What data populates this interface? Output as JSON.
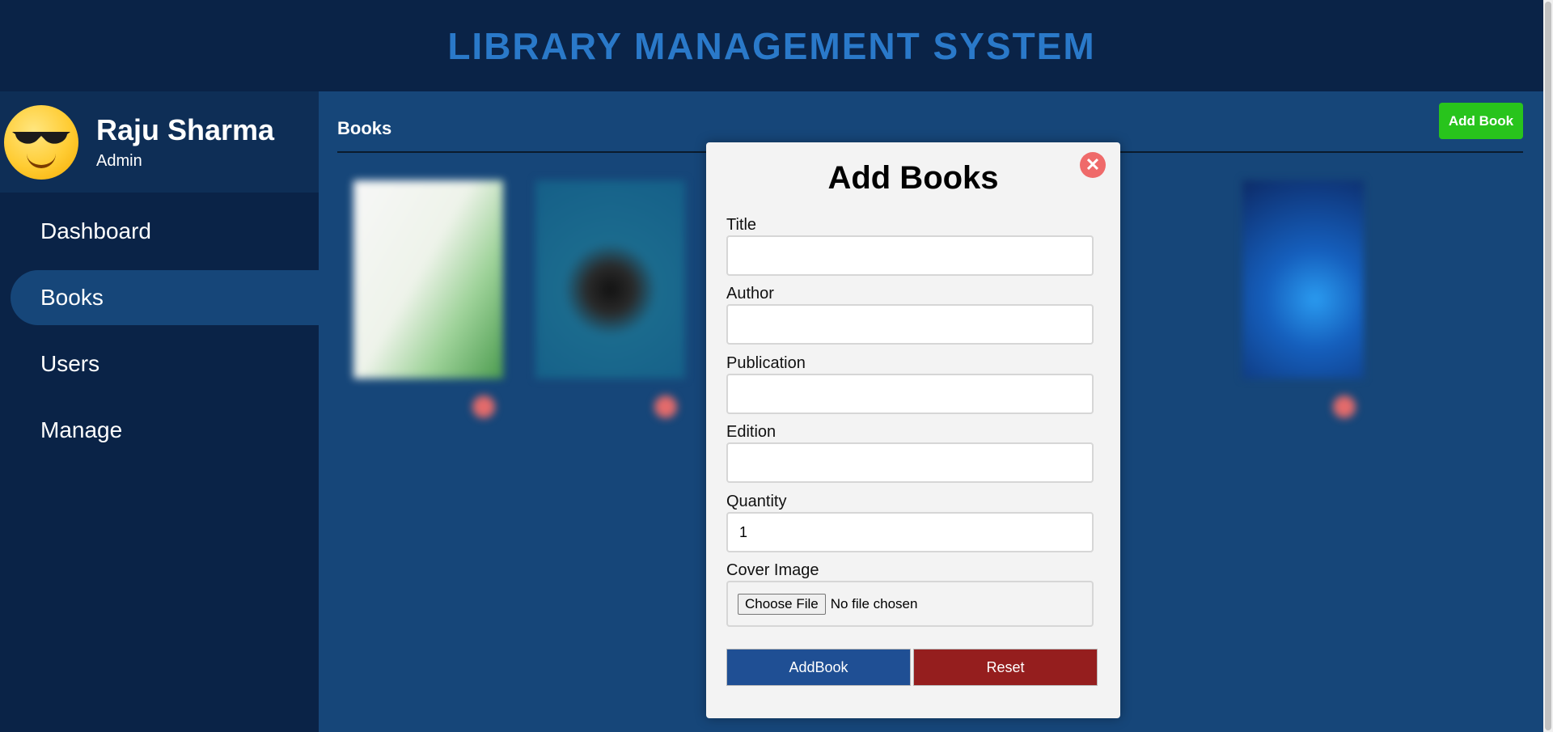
{
  "header": {
    "title": "LIBRARY MANAGEMENT SYSTEM"
  },
  "profile": {
    "name": "Raju Sharma",
    "role": "Admin",
    "avatar_icon": "sunglasses-smiley-icon"
  },
  "sidebar": {
    "items": [
      {
        "label": "Dashboard",
        "active": false
      },
      {
        "label": "Books",
        "active": true
      },
      {
        "label": "Users",
        "active": false
      },
      {
        "label": "Manage",
        "active": false
      }
    ]
  },
  "main": {
    "title": "Books",
    "add_button_label": "Add Book"
  },
  "modal": {
    "title": "Add Books",
    "close_icon": "close-icon",
    "fields": {
      "title": {
        "label": "Title",
        "value": ""
      },
      "author": {
        "label": "Author",
        "value": ""
      },
      "publication": {
        "label": "Publication",
        "value": ""
      },
      "edition": {
        "label": "Edition",
        "value": ""
      },
      "quantity": {
        "label": "Quantity",
        "value": "1"
      },
      "cover": {
        "label": "Cover Image",
        "button": "Choose File",
        "status": "No file chosen"
      }
    },
    "buttons": {
      "add": "AddBook",
      "reset": "Reset"
    }
  },
  "colors": {
    "header_bg": "#0a2347",
    "title_blue": "#2a79c9",
    "main_bg": "#164679",
    "add_green": "#28c41c",
    "add_btn": "#1f4f94",
    "reset_btn": "#951e1e",
    "close_red": "#ef6a6a"
  }
}
